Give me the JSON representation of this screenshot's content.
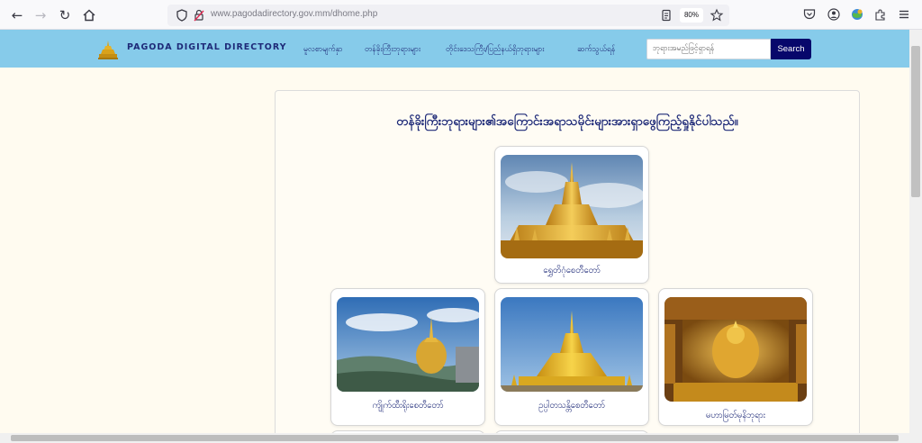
{
  "browser": {
    "url_domain": "www.pagodadirectory.gov.mm",
    "url_path": "/dhome.php",
    "zoom": "80%"
  },
  "site": {
    "title": "PAGODA DIGITAL DIRECTORY",
    "menu": [
      "မူလစာမျက်နှာ",
      "တန်ခိုးကြီးဘုရားများ",
      "တိုင်းဒေသကြီး/ပြည်နယ်ရှိဘုရားများ",
      "ဆက်သွယ်ရန်"
    ],
    "search_placeholder": "ဘုရားအမည်ဖြင့်ရှာရန်",
    "search_label": "Search"
  },
  "main": {
    "headline": "တန်ခိုးကြီးဘုရားများ၏အကြောင်းအရာသမိုင်းများအားရှာဖွေကြည့်ရှုနိုင်ပါသည်။",
    "cards": [
      {
        "label": "ရွှေတိဂုံစေတီတော်"
      },
      {
        "label": "ကျိုက်ထီးရိုးစေတီတော်"
      },
      {
        "label": "ဥပ္ပါတသန္တိစေတီတော်"
      },
      {
        "label": "မဟာမြတ်မုနိဘုရား"
      }
    ]
  },
  "colors": {
    "header_bg": "#86cbea",
    "brand_navy": "#1e2a78",
    "search_button": "#07076b",
    "page_bg": "#fffbf0"
  }
}
